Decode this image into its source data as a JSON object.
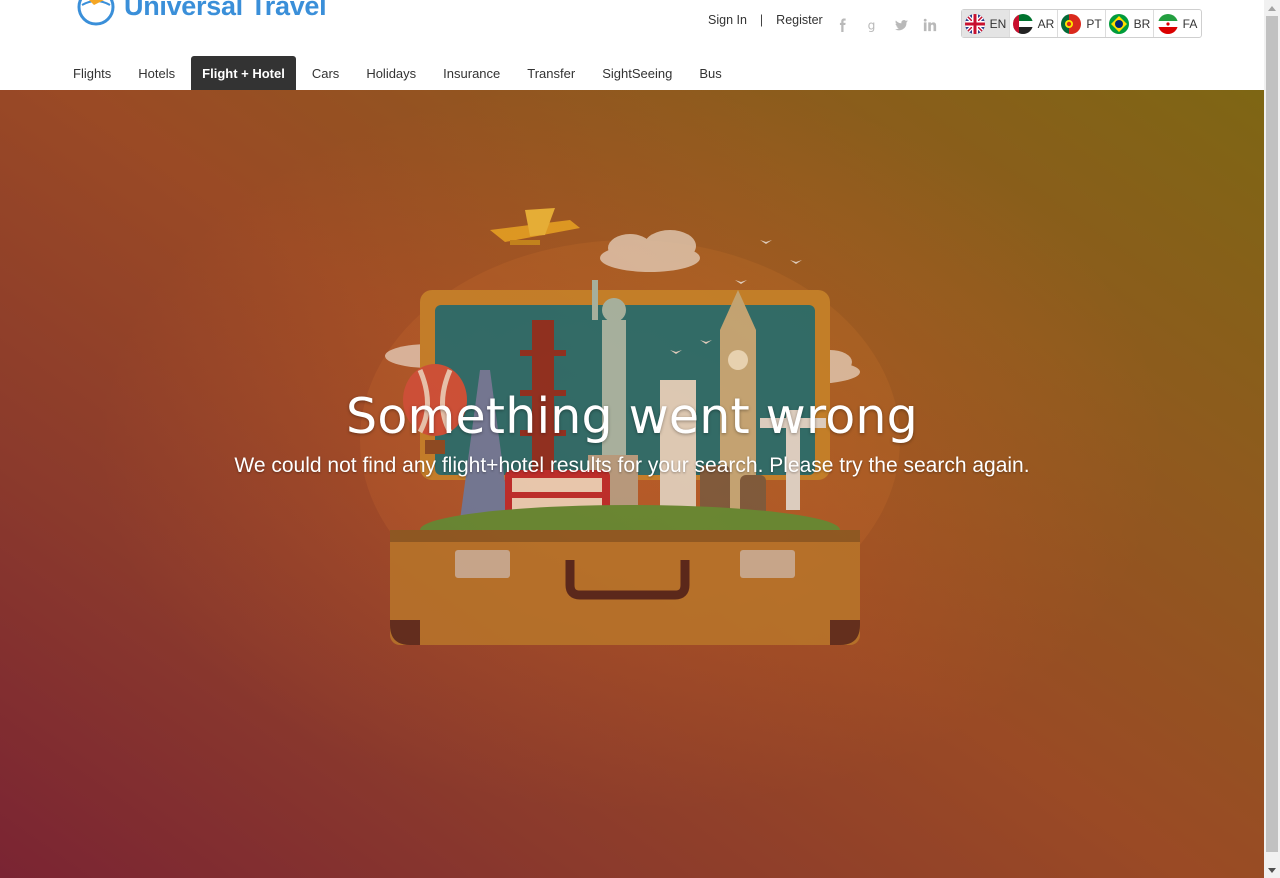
{
  "brand": {
    "name": "Universal Travel",
    "color": "#3a8fd9"
  },
  "auth": {
    "sign_in": "Sign In",
    "separator": "|",
    "register": "Register"
  },
  "social": [
    {
      "name": "facebook-icon",
      "glyph": "f"
    },
    {
      "name": "google-icon",
      "glyph": "g"
    },
    {
      "name": "twitter-icon",
      "glyph": "t"
    },
    {
      "name": "linkedin-icon",
      "glyph": "in"
    }
  ],
  "languages": [
    {
      "code": "EN",
      "flag": "uk-flag-icon",
      "active": true
    },
    {
      "code": "AR",
      "flag": "uae-flag-icon",
      "active": false
    },
    {
      "code": "PT",
      "flag": "portugal-flag-icon",
      "active": false
    },
    {
      "code": "BR",
      "flag": "brazil-flag-icon",
      "active": false
    },
    {
      "code": "FA",
      "flag": "iran-flag-icon",
      "active": false
    }
  ],
  "nav": {
    "items": [
      {
        "label": "Flights"
      },
      {
        "label": "Hotels"
      },
      {
        "label": "Flight + Hotel",
        "active": true
      },
      {
        "label": "Cars"
      },
      {
        "label": "Holidays"
      },
      {
        "label": "Insurance"
      },
      {
        "label": "Transfer"
      },
      {
        "label": "SightSeeing"
      },
      {
        "label": "Bus"
      }
    ]
  },
  "hero": {
    "title": "Something went wrong",
    "message": "We could not find any flight+hotel results for your search. Please try the search again."
  }
}
